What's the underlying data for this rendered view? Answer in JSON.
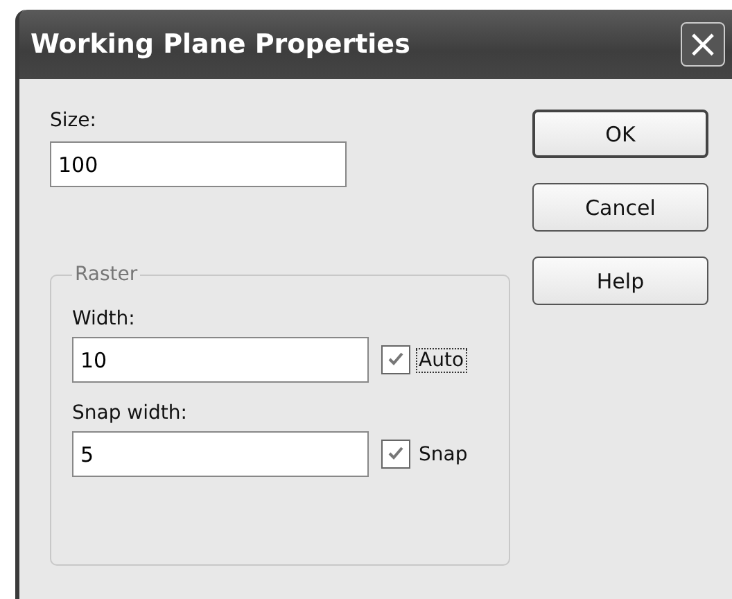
{
  "window": {
    "title": "Working Plane Properties",
    "close": "×"
  },
  "size": {
    "label": "Size:",
    "value": "100"
  },
  "raster": {
    "legend": "Raster",
    "rows": [
      {
        "label": "Width:",
        "value": "10",
        "checkbox": {
          "label": "Auto",
          "checked": true,
          "focused": true
        }
      },
      {
        "label": "Snap width:",
        "value": "5",
        "checkbox": {
          "label": "Snap",
          "checked": true,
          "focused": false
        }
      }
    ]
  },
  "buttons": [
    {
      "label": "OK",
      "default": true
    },
    {
      "label": "Cancel",
      "default": false
    },
    {
      "label": "Help",
      "default": false
    }
  ]
}
